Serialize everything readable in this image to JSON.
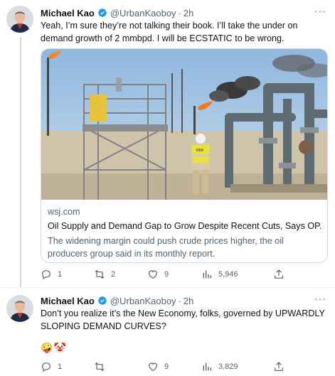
{
  "tweets": [
    {
      "author_name": "Michael Kao",
      "handle": "@UrbanKaoboy",
      "separator": "·",
      "time": "2h",
      "text": "Yeah, I’m sure they’re not talking their book. I’ll take the under on demand growth of 2 mmbpd. I will be ECSTATIC to be wrong.",
      "card": {
        "domain": "wsj.com",
        "title": "Oil Supply and Demand Gap to Grow Despite Recent Cuts, Says OP...",
        "description": "The widening margin could push crude prices higher, the oil producers group said in its monthly report.",
        "vest_text": "KBR"
      },
      "actions": {
        "replies": "1",
        "retweets": "2",
        "likes": "9",
        "views": "5,946"
      }
    },
    {
      "author_name": "Michael Kao",
      "handle": "@UrbanKaoboy",
      "separator": "·",
      "time": "2h",
      "text": "Don’t you realize it’s the New Economy, folks, governed by UPWARDLY SLOPING DEMAND CURVES?",
      "emojis": [
        "🤪",
        "🤡"
      ],
      "actions": {
        "replies": "1",
        "retweets": "",
        "likes": "9",
        "views": "3,829"
      }
    }
  ],
  "colors": {
    "verified": "#1d9bf0",
    "secondary_text": "#536471",
    "border": "#cfd9de"
  },
  "icons": [
    "more-icon",
    "verified-icon",
    "reply-icon",
    "retweet-icon",
    "like-icon",
    "views-icon",
    "share-icon"
  ]
}
